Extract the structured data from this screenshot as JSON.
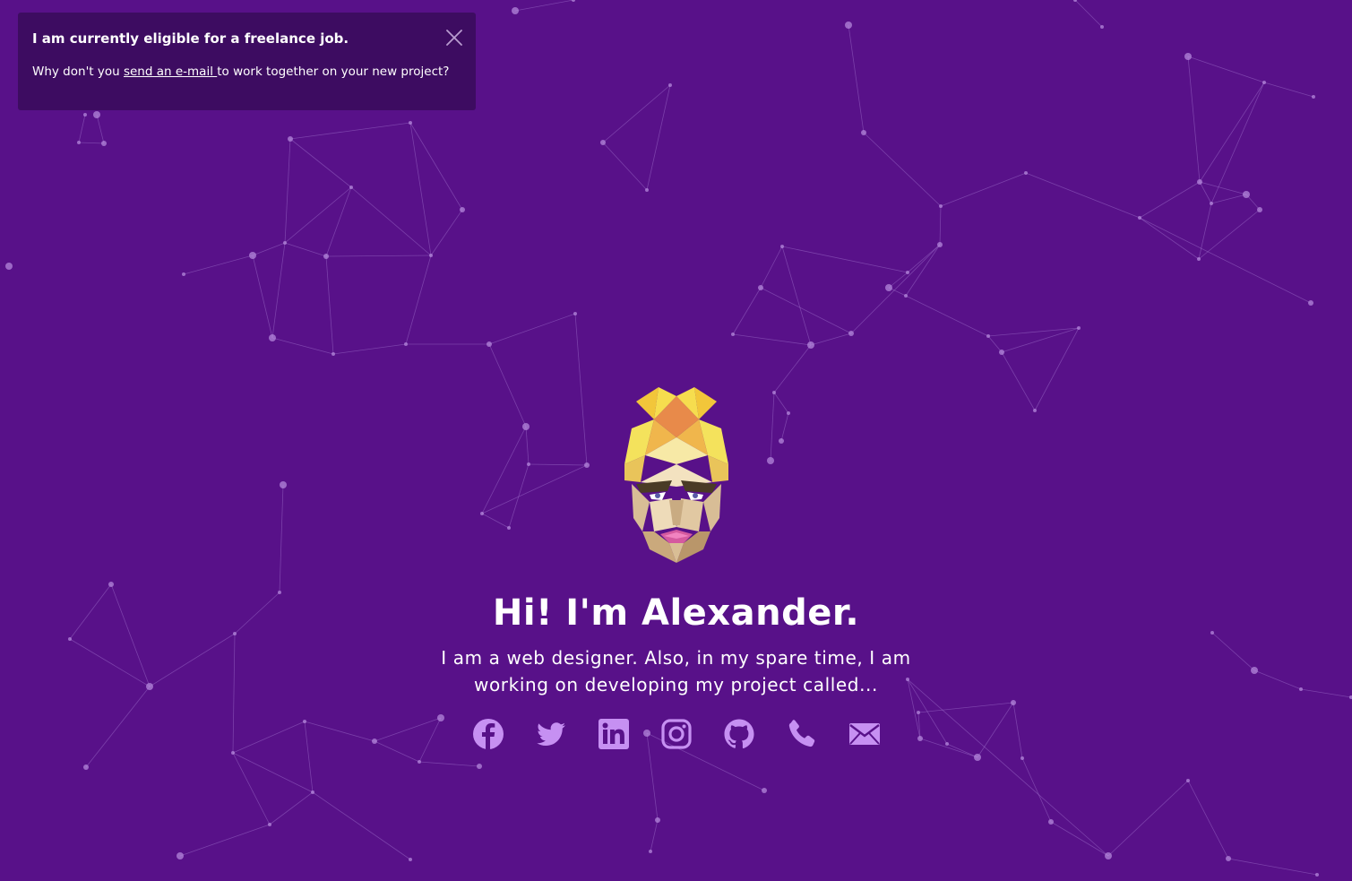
{
  "toast": {
    "title": "I am currently eligible for a freelance job.",
    "body_prefix": "Why don't you ",
    "link_text": "send an e-mail ",
    "body_suffix": "to work together on your new project?",
    "close_icon": "close-icon"
  },
  "hero": {
    "title": "Hi! I'm Alexander.",
    "description": "I am a web designer. Also, in my spare time, I am working on developing my project called..."
  },
  "socials": [
    {
      "name": "facebook",
      "icon": "facebook-icon"
    },
    {
      "name": "twitter",
      "icon": "twitter-icon"
    },
    {
      "name": "linkedin",
      "icon": "linkedin-icon"
    },
    {
      "name": "instagram",
      "icon": "instagram-icon"
    },
    {
      "name": "github",
      "icon": "github-icon"
    },
    {
      "name": "phone",
      "icon": "phone-icon"
    },
    {
      "name": "email",
      "icon": "mail-icon"
    }
  ],
  "colors": {
    "background": "#581189",
    "toast_background": "#3d0c61",
    "icon": "#c690f2",
    "network_line": "#a779d3",
    "network_node": "#b98ee0"
  }
}
